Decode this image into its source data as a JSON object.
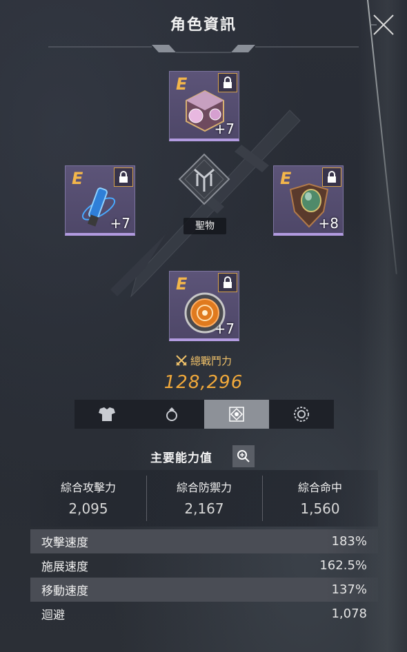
{
  "header": {
    "title": "角色資訊"
  },
  "slots": {
    "top": {
      "grade": "E",
      "enhance": "+7",
      "icon": "crystal-cube"
    },
    "left": {
      "grade": "E",
      "enhance": "+7",
      "icon": "blue-vial"
    },
    "right": {
      "grade": "E",
      "enhance": "+8",
      "icon": "green-gem-amulet"
    },
    "bottom": {
      "grade": "E",
      "enhance": "+7",
      "icon": "orange-disc"
    }
  },
  "center": {
    "label": "聖物"
  },
  "power": {
    "label": "總戰鬥力",
    "value": "128,296"
  },
  "tabs": [
    {
      "icon": "armor-icon"
    },
    {
      "icon": "ring-icon"
    },
    {
      "icon": "relic-icon",
      "active": true
    },
    {
      "icon": "gear-icon"
    }
  ],
  "stats": {
    "title": "主要能力值",
    "main": [
      {
        "name": "綜合攻擊力",
        "value": "2,095"
      },
      {
        "name": "綜合防禦力",
        "value": "2,167"
      },
      {
        "name": "綜合命中",
        "value": "1,560"
      }
    ],
    "rows": [
      {
        "name": "攻擊速度",
        "value": "183%"
      },
      {
        "name": "施展速度",
        "value": "162.5%"
      },
      {
        "name": "移動速度",
        "value": "137%"
      },
      {
        "name": "迴避",
        "value": "1,078"
      }
    ]
  },
  "colors": {
    "grade": "#f3b64a",
    "power": "#f1a93b",
    "slot_border": "#b29be0"
  }
}
